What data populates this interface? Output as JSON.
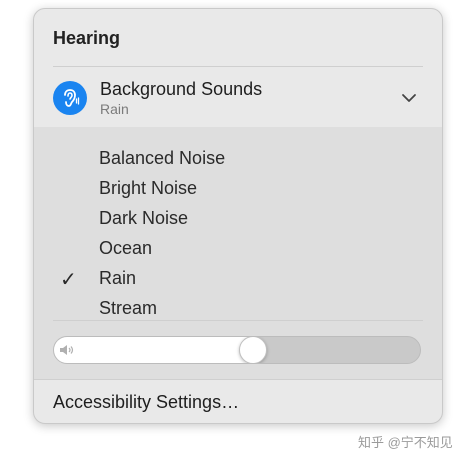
{
  "panel": {
    "title": "Hearing",
    "background_sounds": {
      "title": "Background Sounds",
      "current": "Rain",
      "icon": "ear-icon",
      "accent": "#1a84f0"
    },
    "options": [
      {
        "label": "Balanced Noise",
        "selected": false
      },
      {
        "label": "Bright Noise",
        "selected": false
      },
      {
        "label": "Dark Noise",
        "selected": false
      },
      {
        "label": "Ocean",
        "selected": false
      },
      {
        "label": "Rain",
        "selected": true
      },
      {
        "label": "Stream",
        "selected": false
      }
    ],
    "check_glyph": "✓",
    "volume": {
      "level": 0.5,
      "icon": "speaker-icon"
    },
    "footer": "Accessibility Settings…"
  },
  "watermark": "知乎 @宁不知见"
}
